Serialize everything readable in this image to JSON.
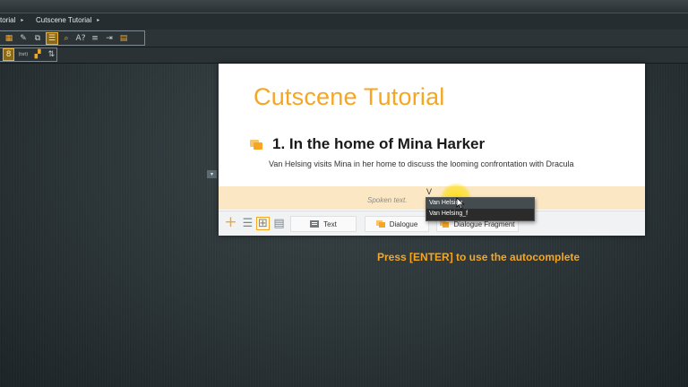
{
  "breadcrumbs": [
    "torial",
    "Cutscene Tutorial"
  ],
  "document": {
    "title": "Cutscene Tutorial",
    "section_title": "1. In the home of Mina Harker",
    "section_desc": "Van Helsing visits Mina in her home to discuss the looming confrontation with Dracula",
    "spoken_placeholder": "Spoken text.",
    "typed_text": "V"
  },
  "doc_toolbar": {
    "text_label": "Text",
    "dialogue_label": "Dialogue",
    "dialogue_fragment_label": "Dialogue Fragment"
  },
  "autocomplete": {
    "items": [
      "Van Helsing",
      "Van Helsing_f"
    ]
  },
  "caption": "Press [ENTER] to use the autocomplete",
  "colors": {
    "accent": "#f5a623",
    "spoken_row": "#fbe7c4"
  }
}
